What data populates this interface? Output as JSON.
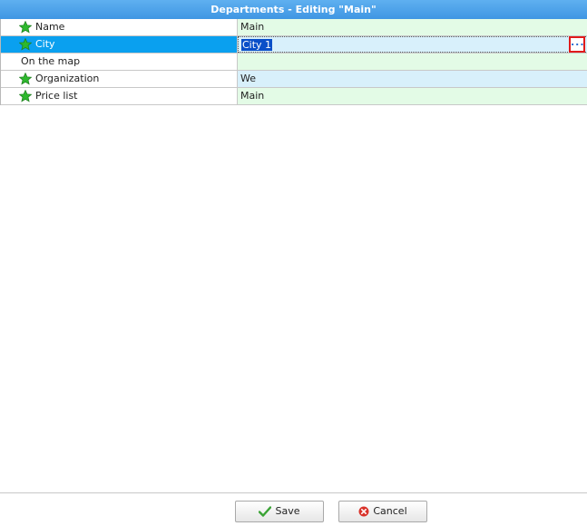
{
  "window": {
    "title": "Departments - Editing \"Main\""
  },
  "fields": [
    {
      "label": "Name",
      "value": "Main",
      "required_icon": "star-icon"
    },
    {
      "label": "City",
      "value": "City 1",
      "required_icon": "star-icon",
      "selected": true,
      "button_label": "..."
    },
    {
      "label": "On the map",
      "value": ""
    },
    {
      "label": "Organization",
      "value": "We",
      "required_icon": "star-icon"
    },
    {
      "label": "Price list",
      "value": "Main",
      "required_icon": "star-icon"
    }
  ],
  "footer": {
    "save_label": "Save",
    "cancel_label": "Cancel",
    "save_icon": "checkmark-icon",
    "cancel_icon": "cancel-icon"
  },
  "colors": {
    "title_bar": "#3f96e3",
    "selected_row": "#0aa0ef",
    "value_green": "#e3fbe6",
    "value_blue": "#d8f0fb",
    "highlight": "#e01b1b",
    "star": "#2eb82e"
  }
}
